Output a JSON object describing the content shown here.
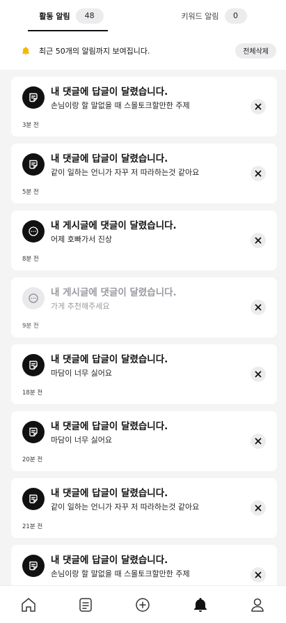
{
  "tabs": [
    {
      "label": "활동 알림",
      "count": "48",
      "active": true
    },
    {
      "label": "키워드 알림",
      "count": "0",
      "active": false
    }
  ],
  "notice": {
    "text": "최근 50개의 알림까지 보여집니다.",
    "clear_label": "전체삭제"
  },
  "notifications": [
    {
      "icon": "reply-bubble-icon",
      "title": "내 댓글에 답글이 달렸습니다.",
      "body": "손님이랑 할 말없을 때 스몰토크할만한 주제",
      "time": "3분 전",
      "read": false
    },
    {
      "icon": "reply-bubble-icon",
      "title": "내 댓글에 답글이 달렸습니다.",
      "body": "같이 일하는 언니가 자꾸 저 따라하는것 같아요",
      "time": "5분 전",
      "read": false
    },
    {
      "icon": "comment-dots-icon",
      "title": "내 게시글에 댓글이 달렸습니다.",
      "body": "어제 호빠가서 진상",
      "time": "8분 전",
      "read": false
    },
    {
      "icon": "comment-dots-icon",
      "title": "내 게시글에 댓글이 달렸습니다.",
      "body": "가게 추천해주세요",
      "time": "9분 전",
      "read": true
    },
    {
      "icon": "reply-bubble-icon",
      "title": "내 댓글에 답글이 달렸습니다.",
      "body": "마담이 너무 싫어요",
      "time": "18분 전",
      "read": false
    },
    {
      "icon": "reply-bubble-icon",
      "title": "내 댓글에 답글이 달렸습니다.",
      "body": "마담이 너무 싫어요",
      "time": "20분 전",
      "read": false
    },
    {
      "icon": "reply-bubble-icon",
      "title": "내 댓글에 답글이 달렸습니다.",
      "body": "같이 일하는 언니가 자꾸 저 따라하는것 같아요",
      "time": "21분 전",
      "read": false
    },
    {
      "icon": "reply-bubble-icon",
      "title": "내 댓글에 답글이 달렸습니다.",
      "body": "손님이랑 할 말없을 때 스몰토크할만한 주제",
      "time": "",
      "read": false
    }
  ],
  "nav": [
    {
      "icon": "home-icon",
      "active": false
    },
    {
      "icon": "board-icon",
      "active": false
    },
    {
      "icon": "plus-circle-icon",
      "active": false
    },
    {
      "icon": "bell-icon",
      "active": true
    },
    {
      "icon": "profile-icon",
      "active": false
    }
  ],
  "colors": {
    "accent_bell": "#f5b800",
    "text": "#111111",
    "chip": "#ececee"
  }
}
